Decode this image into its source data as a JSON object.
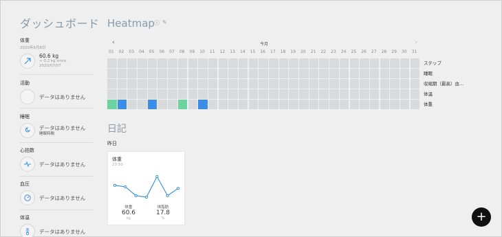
{
  "sidebar": {
    "title": "ダッシュボード",
    "metrics": [
      {
        "label": "体重",
        "date": "2020年6月8日",
        "value": "60.6 kg",
        "sub1": "+ 0.2 kg since",
        "sub2": "2020/07/07",
        "icon": "trend-up-icon"
      },
      {
        "label": "活動",
        "value": "データはありません",
        "icon": "empty-icon"
      },
      {
        "label": "睡眠",
        "value": "データはありません",
        "sub1": "睡眠時間",
        "icon": "sleep-icon"
      },
      {
        "label": "心拍数",
        "value": "データはありません",
        "icon": "heartbeat-icon"
      },
      {
        "label": "血圧",
        "value": "データはありません",
        "icon": "gauge-icon"
      },
      {
        "label": "体温",
        "value": "データはありません",
        "icon": "thermometer-icon"
      }
    ]
  },
  "heatmap": {
    "title": "Heatmap",
    "month": "今月",
    "days": [
      "01",
      "02",
      "03",
      "04",
      "05",
      "06",
      "07",
      "08",
      "09",
      "10",
      "11",
      "12",
      "13",
      "14",
      "15",
      "16",
      "17",
      "18",
      "19",
      "20",
      "21",
      "22",
      "23",
      "24",
      "25",
      "26",
      "27",
      "28",
      "29",
      "30",
      "31"
    ],
    "rows": [
      "ステップ",
      "睡眠",
      "収縮期（最高）血…",
      "体温",
      "体重"
    ],
    "weight_cells": {
      "1": "green",
      "2": "blue",
      "5": "blue",
      "8": "green",
      "10": "blue"
    },
    "colors": {
      "empty": "#d8dbde",
      "green": "#6cd3a0",
      "blue": "#3b8de6"
    }
  },
  "diary": {
    "title": "日記",
    "yesterday": "昨日",
    "card": {
      "title": "体重",
      "time": "23:50",
      "series": [
        60.6,
        60.5,
        59.9,
        59.8,
        61.2,
        59.9,
        60.4
      ],
      "stats": [
        {
          "label": "体重",
          "value": "60.6",
          "unit": "kg"
        },
        {
          "label": "体脂肪",
          "value": "17.8",
          "unit": "%"
        }
      ]
    }
  },
  "fab": {
    "label": "+"
  },
  "accent": "#2e8bd8"
}
